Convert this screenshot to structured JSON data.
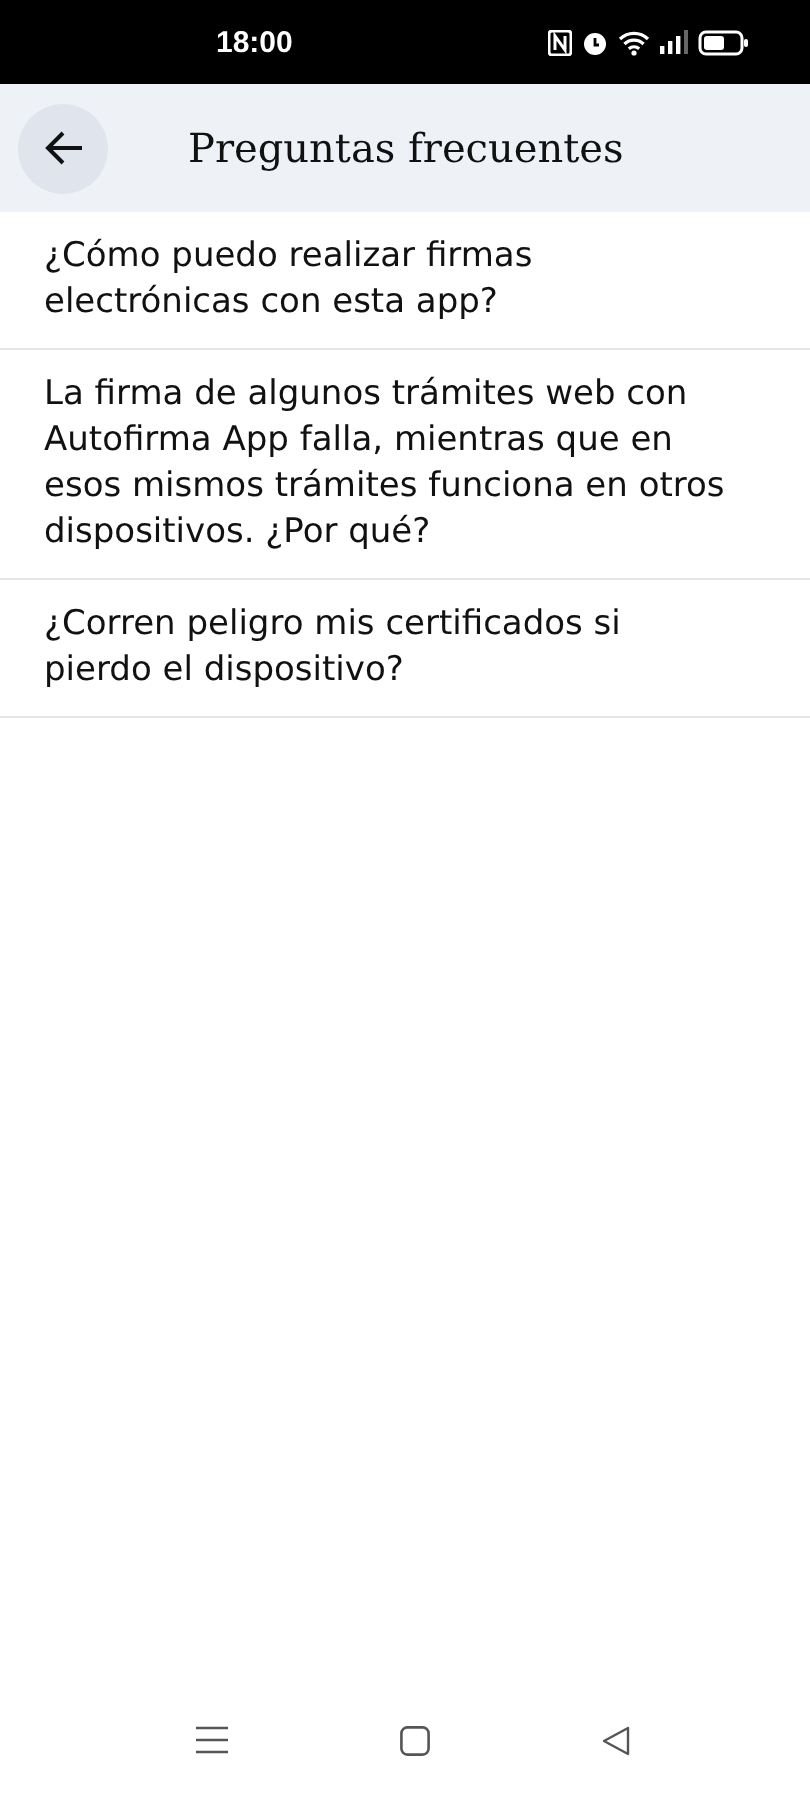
{
  "status_bar": {
    "time": "18:00"
  },
  "header": {
    "title": "Preguntas frecuentes"
  },
  "questions": [
    {
      "text": "¿Cómo puedo realizar firmas electrónicas con esta app?"
    },
    {
      "text": "La firma de algunos trámites web con Autofirma App falla, mientras que en esos mismos trámites funciona en otros dispositivos. ¿Por qué?"
    },
    {
      "text": "¿Corren peligro mis certificados si pierdo el dispositivo?"
    }
  ]
}
